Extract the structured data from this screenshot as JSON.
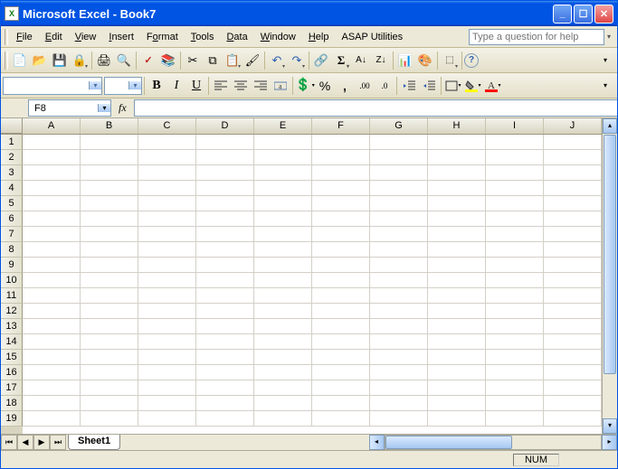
{
  "window": {
    "title": "Microsoft Excel - Book7",
    "app_icon": "X"
  },
  "menu": {
    "items": [
      "File",
      "Edit",
      "View",
      "Insert",
      "Format",
      "Tools",
      "Data",
      "Window",
      "Help",
      "ASAP Utilities"
    ],
    "help_placeholder": "Type a question for help"
  },
  "toolbar_standard": {
    "icons": [
      "new",
      "open",
      "save",
      "permission",
      "print",
      "print-preview",
      "spelling",
      "research",
      "cut",
      "copy",
      "paste",
      "format-painter",
      "undo",
      "redo",
      "hyperlink",
      "autosum",
      "sort-asc",
      "sort-desc",
      "chart-wizard",
      "drawing",
      "zoom",
      "help"
    ]
  },
  "toolbar_formatting": {
    "font_name": "",
    "font_size": "",
    "buttons": [
      "bold",
      "italic",
      "underline",
      "align-left",
      "align-center",
      "align-right",
      "merge-center",
      "currency",
      "percent",
      "comma",
      "increase-decimal",
      "decrease-decimal",
      "decrease-indent",
      "increase-indent",
      "borders",
      "fill-color",
      "font-color"
    ]
  },
  "namebox": {
    "value": "F8"
  },
  "formula_bar": {
    "fx": "fx",
    "value": ""
  },
  "grid": {
    "columns": [
      "A",
      "B",
      "C",
      "D",
      "E",
      "F",
      "G",
      "H",
      "I",
      "J"
    ],
    "rows": [
      1,
      2,
      3,
      4,
      5,
      6,
      7,
      8,
      9,
      10,
      11,
      12,
      13,
      14,
      15,
      16,
      17,
      18,
      19
    ],
    "cells": {}
  },
  "tabs": {
    "sheets": [
      "Sheet1"
    ],
    "active": "Sheet1"
  },
  "statusbar": {
    "mode": "",
    "num": "NUM"
  }
}
